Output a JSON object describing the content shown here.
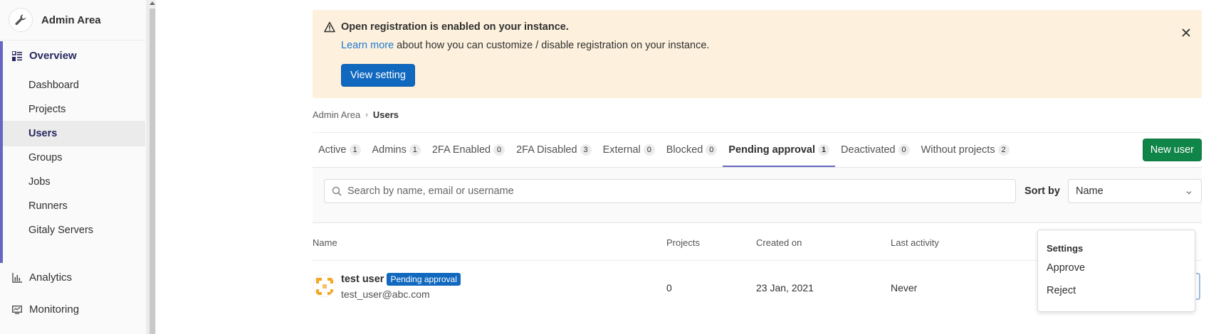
{
  "sidebar": {
    "title": "Admin Area",
    "overview_label": "Overview",
    "items": [
      {
        "label": "Dashboard"
      },
      {
        "label": "Projects"
      },
      {
        "label": "Users"
      },
      {
        "label": "Groups"
      },
      {
        "label": "Jobs"
      },
      {
        "label": "Runners"
      },
      {
        "label": "Gitaly Servers"
      }
    ],
    "analytics_label": "Analytics",
    "monitoring_label": "Monitoring"
  },
  "alert": {
    "title": "Open registration is enabled on your instance.",
    "link_text": "Learn more",
    "body_rest": " about how you can customize / disable registration on your instance.",
    "button_label": "View setting"
  },
  "breadcrumb": {
    "parent": "Admin Area",
    "current": "Users"
  },
  "tabs": [
    {
      "label": "Active",
      "count": "1"
    },
    {
      "label": "Admins",
      "count": "1"
    },
    {
      "label": "2FA Enabled",
      "count": "0"
    },
    {
      "label": "2FA Disabled",
      "count": "3"
    },
    {
      "label": "External",
      "count": "0"
    },
    {
      "label": "Blocked",
      "count": "0"
    },
    {
      "label": "Pending approval",
      "count": "1"
    },
    {
      "label": "Deactivated",
      "count": "0"
    },
    {
      "label": "Without projects",
      "count": "2"
    }
  ],
  "new_user_label": "New user",
  "search": {
    "placeholder": "Search by name, email or username"
  },
  "sort": {
    "label": "Sort by",
    "value": "Name"
  },
  "table": {
    "headers": [
      "Name",
      "Projects",
      "Created on",
      "Last activity"
    ],
    "rows": [
      {
        "name": "test user",
        "badge": "Pending approval",
        "email": "test_user@abc.com",
        "projects": "0",
        "created_on": "23 Jan, 2021",
        "last_activity": "Never"
      }
    ]
  },
  "dropdown": {
    "header": "Settings",
    "items": [
      "Approve",
      "Reject"
    ]
  },
  "colors": {
    "sidebar_accent": "#6666c4",
    "primary": "#1068bf",
    "success": "#108548",
    "warning_bg": "#fdf1dd"
  }
}
